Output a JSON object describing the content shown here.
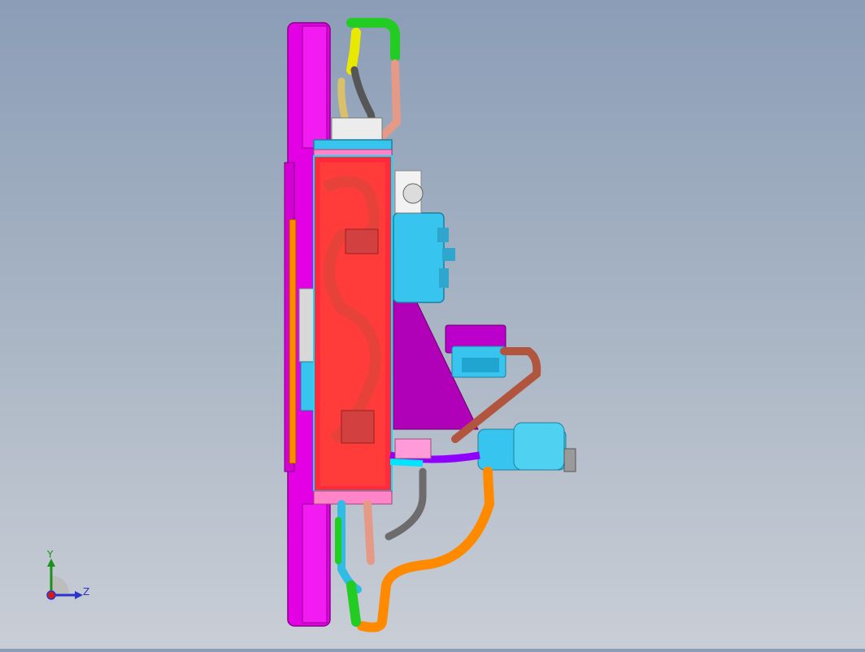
{
  "viewport": {
    "background_top": "#8b9db7",
    "background_bottom": "#c9ced6"
  },
  "triad": {
    "y_label": "Y",
    "z_label": "Z",
    "y_color": "#1d8f1d",
    "z_color": "#2b34c9",
    "x_color": "#d21c1c"
  },
  "model": {
    "frame_color": "#e400e4",
    "core_color": "#ff2a3a",
    "tank_color": "#35c8f0",
    "bracket_color": "#bb00cc"
  }
}
